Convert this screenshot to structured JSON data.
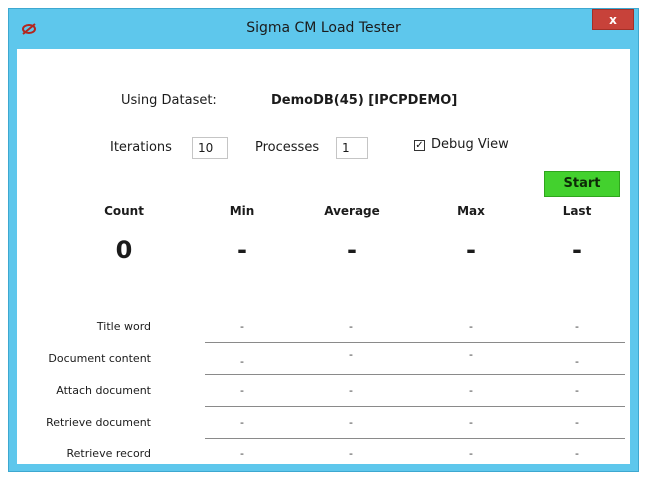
{
  "window": {
    "title": "Sigma CM Load Tester",
    "close_label": "x"
  },
  "dataset": {
    "label": "Using Dataset:",
    "value": "DemoDB(45) [IPCPDEMO]"
  },
  "controls": {
    "iterations_label": "Iterations",
    "iterations_value": "10",
    "processes_label": "Processes",
    "processes_value": "1",
    "debug_label": "Debug View",
    "debug_checked": true,
    "start_label": "Start"
  },
  "summary": {
    "headers": [
      "Count",
      "Min",
      "Average",
      "Max",
      "Last"
    ],
    "values": [
      "0",
      "-",
      "-",
      "-",
      "-"
    ]
  },
  "operations": [
    {
      "label": "Title word",
      "min": "-",
      "average": "-",
      "max": "-",
      "last": "-"
    },
    {
      "label": "Document content",
      "min": "-",
      "average": "-",
      "max": "-",
      "last": "-"
    },
    {
      "label": "Attach document",
      "min": "-",
      "average": "-",
      "max": "-",
      "last": "-"
    },
    {
      "label": "Retrieve document",
      "min": "-",
      "average": "-",
      "max": "-",
      "last": "-"
    },
    {
      "label": "Retrieve record",
      "min": "-",
      "average": "-",
      "max": "-",
      "last": "-"
    }
  ]
}
